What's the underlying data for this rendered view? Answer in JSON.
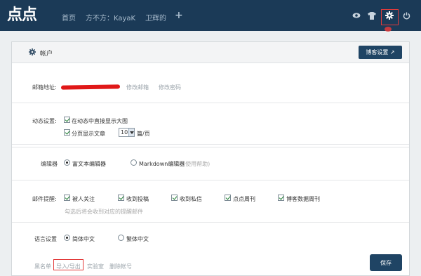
{
  "topbar": {
    "logo": "点点",
    "nav": [
      "首页",
      "方不方：KayaK",
      "卫辉的"
    ],
    "plus": "+",
    "icons": [
      "eye-icon",
      "tshirt-icon",
      "gear-icon",
      "power-icon"
    ]
  },
  "panel": {
    "title": "帐户",
    "blog_settings_label": "博客设置 ↗"
  },
  "email": {
    "label": "邮箱地址:",
    "change_email": "修改邮箱",
    "change_password": "修改密码"
  },
  "feed": {
    "label": "动态设置:",
    "option_big_image": "在动态中直接显示大图",
    "option_paging": "分页显示文章",
    "per_page": "10",
    "per_page_unit": "篇/页"
  },
  "editor": {
    "label": "编辑器",
    "rich": "富文本编辑器",
    "markdown": "Markdown编辑器",
    "markdown_hint": "(使用帮助)"
  },
  "mail": {
    "label": "邮件提醒:",
    "options": [
      "被人关注",
      "收到投稿",
      "收到私信",
      "点点周刊",
      "博客数据周刊"
    ],
    "hint": "勾选后将会收到对应的提醒邮件"
  },
  "language": {
    "label": "语言设置",
    "simplified": "简体中文",
    "traditional": "繁体中文"
  },
  "footer": {
    "links": [
      "黑名单",
      "导入/导出",
      "实验室",
      "删除帐号"
    ],
    "save": "保存"
  }
}
